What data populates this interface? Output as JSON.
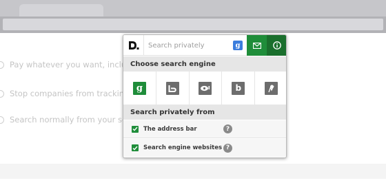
{
  "background": {
    "items": [
      {
        "label": "Pay whatever you want, includin"
      },
      {
        "label": "Stop companies from tracking &"
      },
      {
        "label": "Search normally from your sear"
      }
    ]
  },
  "popup": {
    "search": {
      "placeholder": "Search privately"
    },
    "engine_badge": "g",
    "choose_engine_label": "Choose search engine",
    "engines": [
      {
        "name": "google",
        "glyph": "g",
        "selected": true
      },
      {
        "name": "bing",
        "glyph": "",
        "selected": false
      },
      {
        "name": "yahoo",
        "glyph": "",
        "selected": false
      },
      {
        "name": "blekko",
        "glyph": "b",
        "selected": false
      },
      {
        "name": "wikipedia",
        "glyph": "",
        "selected": false
      }
    ],
    "search_from_label": "Search privately from",
    "options": [
      {
        "label": "The address bar",
        "checked": true
      },
      {
        "label": "Search engine websites",
        "checked": true
      }
    ],
    "help_glyph": "?"
  },
  "colors": {
    "accent_green": "#1f8d3a",
    "dark_green": "#1a6f2d",
    "google_badge_blue": "#3b7ddd",
    "engine_gray": "#6d6d6d"
  }
}
